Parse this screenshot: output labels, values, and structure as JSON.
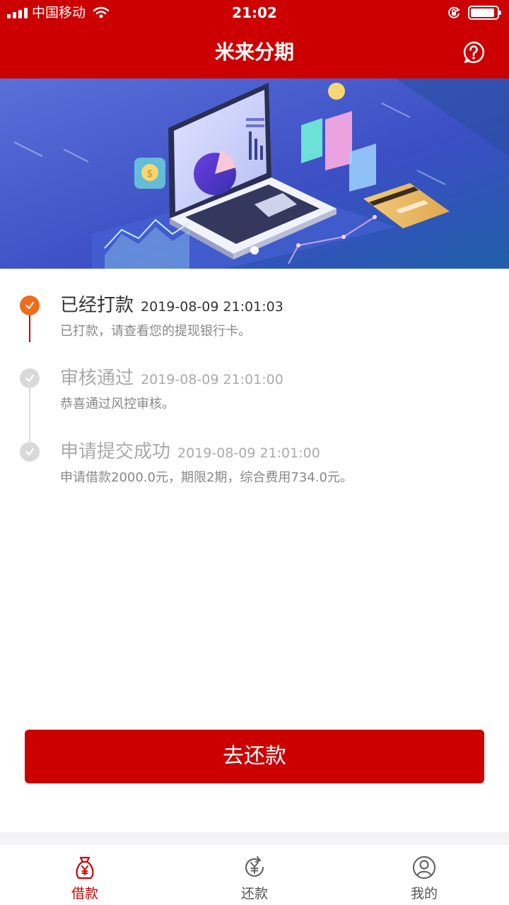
{
  "status_bar": {
    "carrier": "中国移动",
    "time": "21:02",
    "battery_level": 0.92
  },
  "nav": {
    "title": "米来分期",
    "help_icon": "question-bubble-icon"
  },
  "banner": {
    "illustration": "laptop-finance-illustration"
  },
  "timeline": {
    "steps": [
      {
        "title": "已经打款",
        "time": "2019-08-09 21:01:03",
        "desc": "已打款，请查看您的提现银行卡。",
        "status": "done-current"
      },
      {
        "title": "审核通过",
        "time": "2019-08-09 21:01:00",
        "desc": "恭喜通过风控审核。",
        "status": "done"
      },
      {
        "title": "申请提交成功",
        "time": "2019-08-09 21:01:00",
        "desc": "申请借款2000.0元，期限2期，综合费用734.0元。",
        "status": "done"
      }
    ]
  },
  "actions": {
    "repay_label": "去还款"
  },
  "tabbar": {
    "items": [
      {
        "label": "借款",
        "icon": "money-bag-icon",
        "active": true
      },
      {
        "label": "还款",
        "icon": "yuan-refresh-icon",
        "active": false
      },
      {
        "label": "我的",
        "icon": "user-circle-icon",
        "active": false
      }
    ]
  },
  "colors": {
    "brand_red": "#cc0000",
    "accent_orange": "#ef6c1a",
    "text_dark": "#333333",
    "text_gray": "#999999",
    "dot_gray": "#d9d9d9",
    "tab_inactive": "#555555"
  }
}
